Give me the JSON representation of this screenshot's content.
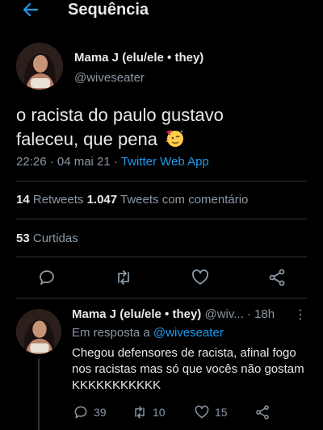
{
  "header": {
    "title": "Sequência"
  },
  "tweet": {
    "name": "Mama J (elu/ele • they)",
    "handle": "@wiveseater",
    "text_line1": "o racista do paulo gustavo",
    "text_line2": "faleceu, que pena",
    "emoji": "partying-face",
    "time": "22:26 · 04 mai 21 · ",
    "source": "Twitter Web App",
    "retweets_count": "14",
    "retweets_label": " Retweets  ",
    "quotes_count": "1.047",
    "quotes_label": " Tweets com comentário",
    "likes_count": "53",
    "likes_label": " Curtidas"
  },
  "reply": {
    "name": "Mama J (elu/ele • they)",
    "handle": " @wiv... · 18h",
    "kebab": "⋮",
    "in_reply_prefix": "Em resposta a ",
    "in_reply_handle": "@wiveseater",
    "text": "Chegou defensores de racista, afinal fogo nos racistas mas só que vocês não gostam KKKKKKKKKKK",
    "replies": "39",
    "retweets": "10",
    "likes": "15"
  },
  "colors": {
    "background": "#000000",
    "text": "#e7e9ea",
    "muted": "#8b98a5",
    "accent": "#1d9bf0",
    "divider": "#2f3336"
  }
}
